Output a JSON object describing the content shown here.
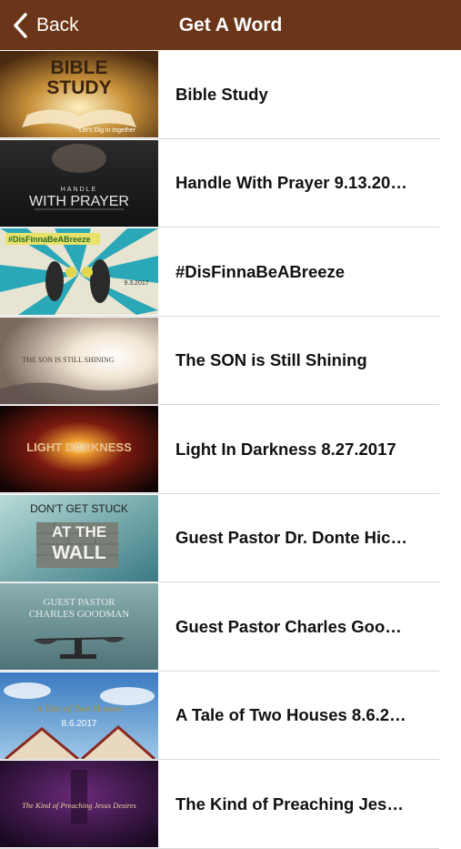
{
  "nav": {
    "back_label": "Back",
    "title": "Get A Word"
  },
  "sermons": [
    {
      "title": "Bible Study",
      "thumb_lines": [
        "BIBLE",
        "STUDY",
        "Let's Dig in together"
      ]
    },
    {
      "title": "Handle With Prayer 9.13.20…",
      "thumb_lines": [
        "HANDLE",
        "WITH PRAYER"
      ]
    },
    {
      "title": "#DisFinnaBeABreeze",
      "thumb_lines": [
        "#DisFinnaBeABreeze",
        "9.3.2017"
      ]
    },
    {
      "title": "The SON is Still Shining",
      "thumb_lines": [
        "THE SON IS STILL SHINING"
      ]
    },
    {
      "title": "Light In Darkness 8.27.2017",
      "thumb_lines": [
        "LIGHT DARKNESS"
      ]
    },
    {
      "title": "Guest Pastor Dr. Donte Hic…",
      "thumb_lines": [
        "DON'T GET STUCK",
        "AT THE",
        "WALL"
      ]
    },
    {
      "title": "Guest Pastor Charles Goo…",
      "thumb_lines": [
        "GUEST PASTOR",
        "CHARLES GOODMAN"
      ]
    },
    {
      "title": "A Tale of Two Houses 8.6.2…",
      "thumb_lines": [
        "A Tale of Two Houses",
        "8.6.2017"
      ]
    },
    {
      "title": "The Kind of Preaching Jes…",
      "thumb_lines": [
        "The Kind of Preaching Jesus Desires"
      ]
    }
  ],
  "colors": {
    "nav_bg": "#6a3518",
    "nav_text": "#ffffff",
    "divider": "#d8d8d8"
  }
}
